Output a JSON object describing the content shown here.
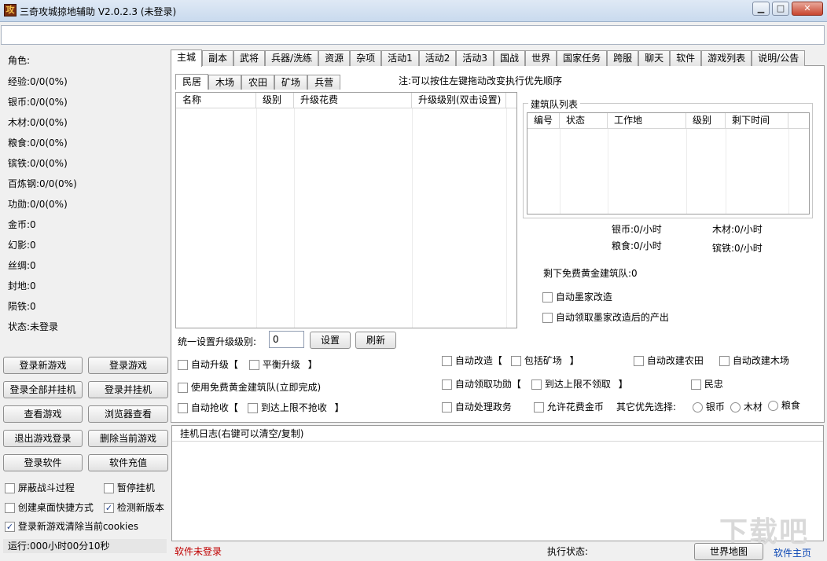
{
  "window": {
    "icon_text": "攻",
    "title": "三奇攻城掠地辅助 V2.0.2.3 (未登录)",
    "min_label": "▁",
    "max_label": "□",
    "close_label": "✕"
  },
  "top_input": {
    "value": ""
  },
  "stats": [
    "角色:",
    "经验:0/0(0%)",
    "银币:0/0(0%)",
    "木材:0/0(0%)",
    "粮食:0/0(0%)",
    "镔铁:0/0(0%)",
    "百炼钢:0/0(0%)",
    "功勋:0/0(0%)",
    "金币:0",
    "幻影:0",
    "丝绸:0",
    "封地:0",
    "陨铁:0",
    "状态:未登录"
  ],
  "left_buttons": [
    [
      "登录新游戏",
      "登录游戏"
    ],
    [
      "登录全部并挂机",
      "登录并挂机"
    ],
    [
      "查看游戏",
      "浏览器查看"
    ],
    [
      "退出游戏登录",
      "删除当前游戏"
    ],
    [
      "登录软件",
      "软件充值"
    ]
  ],
  "left_checks": {
    "hide_battle": {
      "label": "屏蔽战斗过程",
      "checked": false
    },
    "pause": {
      "label": "暂停挂机",
      "checked": false
    },
    "desktop_shortcut": {
      "label": "创建桌面快捷方式",
      "checked": false
    },
    "check_version": {
      "label": "检测新版本",
      "checked": true
    },
    "clear_cookies": {
      "label": "登录新游戏清除当前cookies",
      "checked": true
    }
  },
  "runtime": "运行:000小时00分10秒",
  "tabs": [
    "主城",
    "副本",
    "武将",
    "兵器/洗练",
    "资源",
    "杂项",
    "活动1",
    "活动2",
    "活动3",
    "国战",
    "世界",
    "国家任务",
    "跨服",
    "聊天",
    "软件",
    "游戏列表",
    "说明/公告"
  ],
  "active_tab": 0,
  "subtabs": [
    "民居",
    "木场",
    "农田",
    "矿场",
    "兵营"
  ],
  "active_subtab": 0,
  "hint": "注:可以按住左键拖动改变执行优先顺序",
  "building_grid": {
    "columns": [
      "名称",
      "级别",
      "升级花费",
      "升级级别(双击设置)"
    ]
  },
  "queue": {
    "title": "建筑队列表",
    "columns": [
      "编号",
      "状态",
      "工作地",
      "级别",
      "剩下时间"
    ]
  },
  "rates": {
    "silver": "银币:0/小时",
    "wood": "木材:0/小时",
    "food": "粮食:0/小时",
    "iron": "镔铁:0/小时"
  },
  "free_gold_queue": "剩下免费黄金建筑队:0",
  "mojia": {
    "auto_rebuild": "自动墨家改造",
    "auto_collect": "自动领取墨家改造后的产出"
  },
  "unified": {
    "label": "统一设置升级级别:",
    "value": "0",
    "set_button": "设置",
    "refresh_button": "刷新"
  },
  "options": {
    "auto_upgrade": "自动升级【",
    "balance_upgrade": "平衡升级",
    "close_bracket": "】",
    "use_free_gold": "使用免费黄金建筑队(立即完成)",
    "auto_grab": "自动抢收【",
    "no_grab_at_limit": "到达上限不抢收",
    "auto_improve": "自动改造【",
    "include_mine": "包括矿场",
    "auto_merit": "自动领取功勋【",
    "no_collect_at_limit": "到达上限不领取",
    "auto_affairs": "自动处理政务",
    "allow_gold": "允许花费金币",
    "other_priority": "其它优先选择:",
    "radio_silver": "银币",
    "radio_wood": "木材",
    "radio_food": "粮食",
    "auto_rebuild_farm": "自动改建农田",
    "auto_rebuild_wood": "自动改建木场",
    "loyalty": "民忠"
  },
  "log": {
    "title": "挂机日志(右键可以清空/复制)"
  },
  "statusbar": {
    "software_status": "软件未登录",
    "exec_label": "执行状态:",
    "world_map_button": "世界地图",
    "home_link": "软件主页"
  },
  "watermark": "下载吧"
}
